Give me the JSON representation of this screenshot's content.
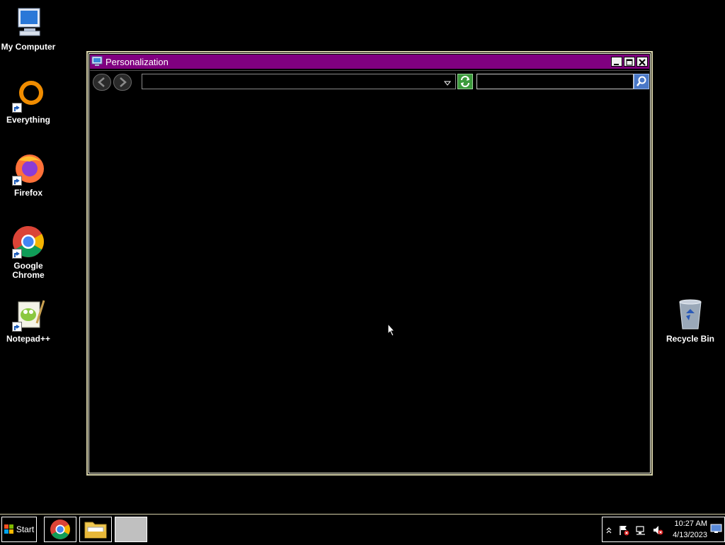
{
  "desktop": {
    "icons": [
      {
        "label": "My Computer",
        "icon": "computer-icon"
      },
      {
        "label": "Everything",
        "icon": "everything-icon"
      },
      {
        "label": "Firefox",
        "icon": "firefox-icon"
      },
      {
        "label": "Google Chrome",
        "icon": "chrome-icon"
      },
      {
        "label": "Notepad++",
        "icon": "notepadpp-icon"
      },
      {
        "label": "Recycle Bin",
        "icon": "recycle-bin-icon"
      }
    ]
  },
  "window": {
    "title": "Personalization",
    "address": {
      "value": "",
      "placeholder": ""
    },
    "search": {
      "value": "",
      "placeholder": ""
    }
  },
  "taskbar": {
    "start_label": "Start",
    "apps": [
      {
        "name": "Google Chrome",
        "icon": "chrome-icon"
      },
      {
        "name": "File Explorer",
        "icon": "folder-icon"
      },
      {
        "name": "Personalization",
        "icon": "blank-window-icon"
      }
    ],
    "clock": {
      "time": "10:27 AM",
      "date": "4/13/2023"
    }
  },
  "colors": {
    "titlebar": "#800080",
    "desktop": "#000000",
    "border": "#d4d0a8"
  }
}
